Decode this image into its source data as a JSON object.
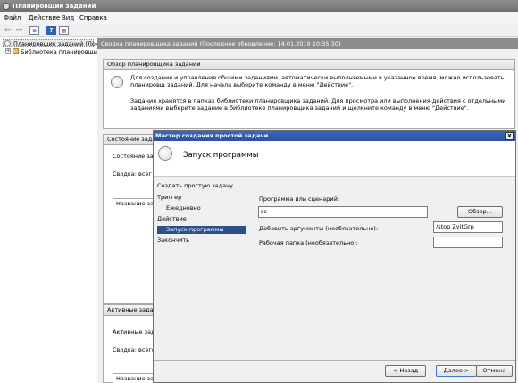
{
  "window": {
    "title": "Планировщик заданий"
  },
  "menu": {
    "items": [
      "Файл",
      "Действие",
      "Вид",
      "Справка"
    ]
  },
  "toolbar": {
    "icons": [
      "back-arrow-icon",
      "forward-arrow-icon",
      "console-tree-icon",
      "help-icon",
      "properties-icon"
    ],
    "help_glyph": "?"
  },
  "tree": {
    "root": "Планировщик заданий (Локал",
    "library": "Библиотека планировщика",
    "expand_glyph": "+"
  },
  "summary": {
    "header": "Сводка планировщика заданий (Последнее обновление: 14.01.2019 10:35:30)",
    "overview": {
      "title": "Обзор планировщика заданий",
      "p1": "Для создания и управления общими заданиями, автоматически выполняемыми в указанное время, можно использовать планировщ заданий. Для начала выберите команду в меню \"Действие\".",
      "p2": "Задания хранятся в папках библиотеки планировщика заданий. Для просмотра или выполнения действия с отдельными заданиями выберите задание в библиотеке планировщика заданий и щелкните команду в меню \"Действие\"."
    },
    "status": {
      "title": "Состояние зада",
      "line1": "Состояние зад",
      "line2": "Сводка: всег",
      "col": "Название зада"
    },
    "active": {
      "title": "Активные задач",
      "line1": "Активные зада",
      "line2": "Сводка: всего",
      "col": "Название зада"
    }
  },
  "dialog": {
    "title": "Мастер создания простой задачи",
    "close_glyph": "x",
    "heading": "Запуск программы",
    "steps": [
      {
        "label": "Создать простую задачу",
        "selected": false
      },
      {
        "label": "Триггер",
        "selected": false
      },
      {
        "label": "Ежедневно",
        "selected": false
      },
      {
        "label": "Действие",
        "selected": false
      },
      {
        "label": "Запуск программы",
        "selected": true
      },
      {
        "label": "Закончить",
        "selected": false
      }
    ],
    "program_label": "Программа или сценарий:",
    "program_value": "sc",
    "browse_label": "Обзор...",
    "args_label": "Добавить аргументы (необязательно):",
    "args_value": "/stop ZvitGrp",
    "workdir_label": "Рабочая папка (необязательно):",
    "workdir_value": "",
    "back_label": "< Назад",
    "next_label": "Далее >",
    "cancel_label": "Отмена"
  },
  "colors": {
    "dialog_title": "#2a52a0",
    "selected_step": "#2e4f8a",
    "window_title": "#7a7a7a"
  }
}
